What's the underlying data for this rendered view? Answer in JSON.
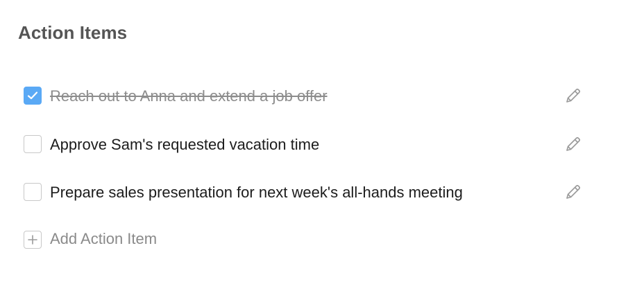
{
  "title": "Action Items",
  "items": [
    {
      "label": "Reach out to Anna and extend a job offer",
      "checked": true,
      "edit_icon": "pencil-icon"
    },
    {
      "label": "Approve Sam's requested vacation time",
      "checked": false,
      "edit_icon": "pencil-icon"
    },
    {
      "label": "Prepare sales presentation for next week's all-hands meeting",
      "checked": false,
      "edit_icon": "pencil-icon"
    }
  ],
  "add_item": {
    "label": "Add Action Item",
    "icon": "plus-icon"
  },
  "colors": {
    "accent": "#5aa9f5",
    "title": "#555555",
    "muted": "#8a8a8a",
    "border": "#c8c8c8"
  }
}
